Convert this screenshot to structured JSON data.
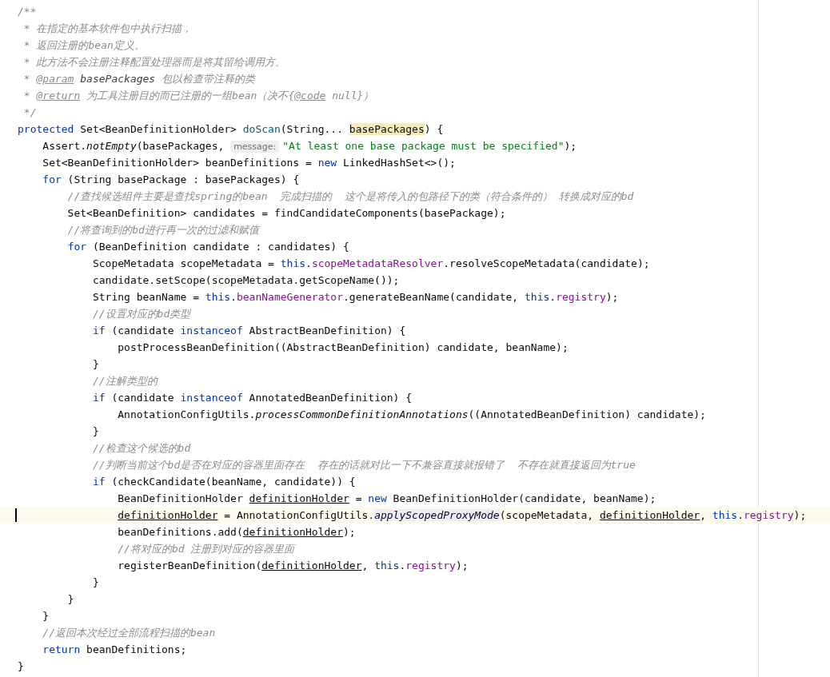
{
  "editor": {
    "lines": [
      {
        "current": false,
        "tokens": [
          {
            "kind": "comment",
            "text": "/**"
          }
        ]
      },
      {
        "current": false,
        "tokens": [
          {
            "kind": "comment",
            "text": " * 在指定的基本软件包中执行扫描，"
          }
        ]
      },
      {
        "current": false,
        "tokens": [
          {
            "kind": "comment",
            "text": " * 返回注册的bean定义。"
          }
        ]
      },
      {
        "current": false,
        "tokens": [
          {
            "kind": "comment",
            "text": " * 此方法不会注册注释配置处理器而是将其留给调用方。"
          }
        ]
      },
      {
        "current": false,
        "tokens": [
          {
            "kind": "comment",
            "text": " * "
          },
          {
            "kind": "doc-tag",
            "text": "@param"
          },
          {
            "kind": "doc-param",
            "text": " basePackages"
          },
          {
            "kind": "comment",
            "text": " 包以检查带注释的类"
          }
        ]
      },
      {
        "current": false,
        "tokens": [
          {
            "kind": "comment",
            "text": " * "
          },
          {
            "kind": "doc-tag",
            "text": "@return"
          },
          {
            "kind": "comment",
            "text": " 为工具注册目的而已注册的一组bean（决不{"
          },
          {
            "kind": "doc-tag",
            "text": "@code"
          },
          {
            "kind": "comment",
            "text": " null}）"
          }
        ]
      },
      {
        "current": false,
        "tokens": [
          {
            "kind": "comment",
            "text": " */"
          }
        ]
      },
      {
        "current": false,
        "tokens": [
          {
            "kind": "keyword",
            "text": "protected"
          },
          {
            "kind": "plain",
            "text": " Set<BeanDefinitionHolder> "
          },
          {
            "kind": "method",
            "text": "doScan"
          },
          {
            "kind": "plain",
            "text": "(String... "
          },
          {
            "kind": "param-highlight",
            "text": "basePackages"
          },
          {
            "kind": "plain",
            "text": ") {"
          }
        ]
      },
      {
        "current": false,
        "tokens": [
          {
            "kind": "plain",
            "text": "    Assert."
          },
          {
            "kind": "italic",
            "text": "notEmpty"
          },
          {
            "kind": "plain",
            "text": "(basePackages, "
          },
          {
            "kind": "hint",
            "text": "message:"
          },
          {
            "kind": "string",
            "text": "\"At least one base package must be specified\""
          },
          {
            "kind": "plain",
            "text": ");"
          }
        ]
      },
      {
        "current": false,
        "tokens": [
          {
            "kind": "plain",
            "text": "    Set<BeanDefinitionHolder> beanDefinitions = "
          },
          {
            "kind": "keyword",
            "text": "new"
          },
          {
            "kind": "plain",
            "text": " LinkedHashSet<>();"
          }
        ]
      },
      {
        "current": false,
        "tokens": [
          {
            "kind": "keyword",
            "text": "    for"
          },
          {
            "kind": "plain",
            "text": " (String basePackage : basePackages) {"
          }
        ]
      },
      {
        "current": false,
        "tokens": [
          {
            "kind": "comment",
            "text": "        //查找候选组件主要是查找spring的bean  完成扫描的  这个是将传入的包路径下的类（符合条件的） 转换成对应的bd"
          }
        ]
      },
      {
        "current": false,
        "tokens": [
          {
            "kind": "plain",
            "text": "        Set<BeanDefinition> candidates = findCandidateComponents(basePackage);"
          }
        ]
      },
      {
        "current": false,
        "tokens": [
          {
            "kind": "comment",
            "text": "        //将查询到的bd进行再一次的过滤和赋值"
          }
        ]
      },
      {
        "current": false,
        "tokens": [
          {
            "kind": "keyword",
            "text": "        for"
          },
          {
            "kind": "plain",
            "text": " (BeanDefinition candidate : candidates) {"
          }
        ]
      },
      {
        "current": false,
        "tokens": [
          {
            "kind": "plain",
            "text": "            ScopeMetadata scopeMetadata = "
          },
          {
            "kind": "keyword",
            "text": "this"
          },
          {
            "kind": "field",
            "text": ".scopeMetadataResolver"
          },
          {
            "kind": "plain",
            "text": ".resolveScopeMetadata(candidate);"
          }
        ]
      },
      {
        "current": false,
        "tokens": [
          {
            "kind": "plain",
            "text": "            candidate.setScope(scopeMetadata.getScopeName());"
          }
        ]
      },
      {
        "current": false,
        "tokens": [
          {
            "kind": "plain",
            "text": "            String beanName = "
          },
          {
            "kind": "keyword",
            "text": "this"
          },
          {
            "kind": "field",
            "text": ".beanNameGenerator"
          },
          {
            "kind": "plain",
            "text": ".generateBeanName(candidate, "
          },
          {
            "kind": "keyword",
            "text": "this"
          },
          {
            "kind": "field",
            "text": ".registry"
          },
          {
            "kind": "plain",
            "text": ");"
          }
        ]
      },
      {
        "current": false,
        "tokens": [
          {
            "kind": "comment",
            "text": "            //设置对应的bd类型"
          }
        ]
      },
      {
        "current": false,
        "tokens": [
          {
            "kind": "keyword",
            "text": "            if"
          },
          {
            "kind": "plain",
            "text": " (candidate "
          },
          {
            "kind": "keyword",
            "text": "instanceof"
          },
          {
            "kind": "plain",
            "text": " AbstractBeanDefinition) {"
          }
        ]
      },
      {
        "current": false,
        "tokens": [
          {
            "kind": "plain",
            "text": "                postProcessBeanDefinition((AbstractBeanDefinition) candidate, beanName);"
          }
        ]
      },
      {
        "current": false,
        "tokens": [
          {
            "kind": "plain",
            "text": "            }"
          }
        ]
      },
      {
        "current": false,
        "tokens": [
          {
            "kind": "comment",
            "text": "            //注解类型的"
          }
        ]
      },
      {
        "current": false,
        "tokens": [
          {
            "kind": "keyword",
            "text": "            if"
          },
          {
            "kind": "plain",
            "text": " (candidate "
          },
          {
            "kind": "keyword",
            "text": "instanceof"
          },
          {
            "kind": "plain",
            "text": " AnnotatedBeanDefinition) {"
          }
        ]
      },
      {
        "current": false,
        "tokens": [
          {
            "kind": "plain",
            "text": "                AnnotationConfigUtils."
          },
          {
            "kind": "italic",
            "text": "processCommonDefinitionAnnotations"
          },
          {
            "kind": "plain",
            "text": "((AnnotatedBeanDefinition) candidate);"
          }
        ]
      },
      {
        "current": false,
        "tokens": [
          {
            "kind": "plain",
            "text": "            }"
          }
        ]
      },
      {
        "current": false,
        "tokens": [
          {
            "kind": "comment",
            "text": "            //检查这个候选的bd"
          }
        ]
      },
      {
        "current": false,
        "tokens": [
          {
            "kind": "comment",
            "text": "            //判断当前这个bd是否在对应的容器里面存在  存在的话就对比一下不兼容直接就报错了  不存在就直接返回为true"
          }
        ]
      },
      {
        "current": false,
        "tokens": [
          {
            "kind": "keyword",
            "text": "            if"
          },
          {
            "kind": "plain",
            "text": " (checkCandidate(beanName, candidate)) {"
          }
        ]
      },
      {
        "current": false,
        "tokens": [
          {
            "kind": "plain",
            "text": "                BeanDefinitionHolder "
          },
          {
            "kind": "underline",
            "text": "definitionHolder"
          },
          {
            "kind": "plain",
            "text": " = "
          },
          {
            "kind": "keyword",
            "text": "new"
          },
          {
            "kind": "plain",
            "text": " BeanDefinitionHolder(candidate, beanName);"
          }
        ]
      },
      {
        "current": true,
        "tokens": [
          {
            "kind": "underline",
            "text": "                definitionHolder"
          },
          {
            "kind": "plain",
            "text": " = AnnotationConfigUtils."
          },
          {
            "kind": "italic-highlight",
            "text": "applyScopedProxyMode"
          },
          {
            "kind": "plain",
            "text": "(scopeMetadata, "
          },
          {
            "kind": "underline",
            "text": "definitionHolder"
          },
          {
            "kind": "keyword",
            "text": ", this"
          },
          {
            "kind": "field",
            "text": ".registry"
          },
          {
            "kind": "plain",
            "text": ");"
          }
        ]
      },
      {
        "current": false,
        "tokens": [
          {
            "kind": "plain",
            "text": "                beanDefinitions.add("
          },
          {
            "kind": "underline",
            "text": "definitionHolder"
          },
          {
            "kind": "plain",
            "text": ");"
          }
        ]
      },
      {
        "current": false,
        "tokens": [
          {
            "kind": "comment",
            "text": "                //将对应的bd 注册到对应的容器里面"
          }
        ]
      },
      {
        "current": false,
        "tokens": [
          {
            "kind": "plain",
            "text": "                registerBeanDefinition("
          },
          {
            "kind": "underline",
            "text": "definitionHolder"
          },
          {
            "kind": "keyword",
            "text": ", this"
          },
          {
            "kind": "field",
            "text": ".registry"
          },
          {
            "kind": "plain",
            "text": ");"
          }
        ]
      },
      {
        "current": false,
        "tokens": [
          {
            "kind": "plain",
            "text": "            }"
          }
        ]
      },
      {
        "current": false,
        "tokens": [
          {
            "kind": "plain",
            "text": "        }"
          }
        ]
      },
      {
        "current": false,
        "tokens": [
          {
            "kind": "plain",
            "text": "    }"
          }
        ]
      },
      {
        "current": false,
        "tokens": [
          {
            "kind": "comment",
            "text": "    //返回本次经过全部流程扫描的bean"
          }
        ]
      },
      {
        "current": false,
        "tokens": [
          {
            "kind": "keyword",
            "text": "    return"
          },
          {
            "kind": "plain",
            "text": " beanDefinitions;"
          }
        ]
      },
      {
        "current": false,
        "tokens": [
          {
            "kind": "plain",
            "text": "}"
          }
        ]
      }
    ]
  }
}
